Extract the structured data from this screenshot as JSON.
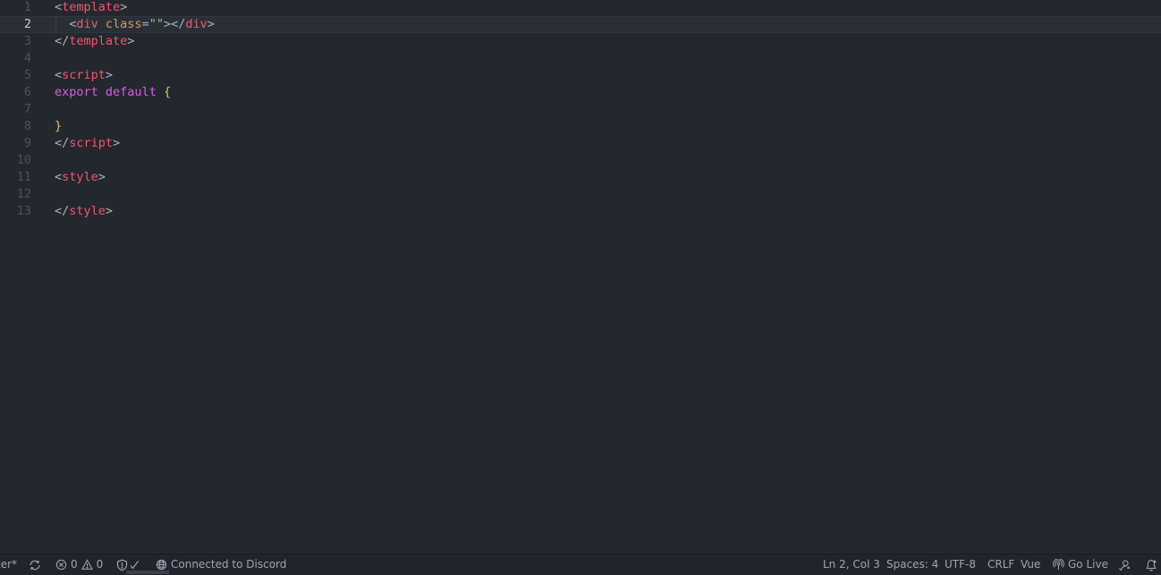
{
  "editor": {
    "current_line": 2,
    "lines": [
      {
        "n": "1",
        "tokens": [
          [
            "t-punc",
            "<"
          ],
          [
            "t-tag",
            "template"
          ],
          [
            "t-punc",
            ">"
          ]
        ]
      },
      {
        "n": "2",
        "tokens": [
          [
            "t-punc",
            "  <"
          ],
          [
            "t-tag",
            "div"
          ],
          [
            "t-punc",
            " "
          ],
          [
            "t-attr",
            "class"
          ],
          [
            "t-punc",
            "="
          ],
          [
            "t-str",
            "\"\""
          ],
          [
            "t-punc",
            "></"
          ],
          [
            "t-tag",
            "div"
          ],
          [
            "t-punc",
            ">"
          ]
        ]
      },
      {
        "n": "3",
        "tokens": [
          [
            "t-punc",
            "</"
          ],
          [
            "t-tag",
            "template"
          ],
          [
            "t-punc",
            ">"
          ]
        ]
      },
      {
        "n": "4",
        "tokens": []
      },
      {
        "n": "5",
        "tokens": [
          [
            "t-punc",
            "<"
          ],
          [
            "t-tag",
            "script"
          ],
          [
            "t-punc",
            ">"
          ]
        ]
      },
      {
        "n": "6",
        "tokens": [
          [
            "t-kw",
            "export"
          ],
          [
            "t-punc",
            " "
          ],
          [
            "t-kw",
            "default"
          ],
          [
            "t-punc",
            " "
          ],
          [
            "t-brace",
            "{"
          ]
        ]
      },
      {
        "n": "7",
        "tokens": []
      },
      {
        "n": "8",
        "tokens": [
          [
            "t-brace",
            "}"
          ]
        ]
      },
      {
        "n": "9",
        "tokens": [
          [
            "t-punc",
            "</"
          ],
          [
            "t-tag",
            "script"
          ],
          [
            "t-punc",
            ">"
          ]
        ]
      },
      {
        "n": "10",
        "tokens": []
      },
      {
        "n": "11",
        "tokens": [
          [
            "t-punc",
            "<"
          ],
          [
            "t-tag",
            "style"
          ],
          [
            "t-punc",
            ">"
          ]
        ]
      },
      {
        "n": "12",
        "tokens": []
      },
      {
        "n": "13",
        "tokens": [
          [
            "t-punc",
            "</"
          ],
          [
            "t-tag",
            "style"
          ],
          [
            "t-punc",
            ">"
          ]
        ]
      }
    ]
  },
  "statusbar": {
    "branch_fragment": "ter*",
    "errors": "0",
    "warnings": "0",
    "discord": "Connected to Discord",
    "cursor_position": "Ln 2, Col 3",
    "indentation": "Spaces: 4",
    "encoding": "UTF-8",
    "line_ending": "CRLF",
    "language": "Vue",
    "go_live": "Go Live"
  },
  "icons": {
    "sync": "sync-icon",
    "error": "error-icon",
    "warning": "warning-icon",
    "shield": "shield-check-icon",
    "globe": "globe-icon",
    "broadcast": "broadcast-icon",
    "feedback": "feedback-icon",
    "bell": "bell-icon"
  },
  "colors": {
    "background": "#23272e",
    "tag": "#ef596f",
    "attribute": "#d19a66",
    "string": "#89ca78",
    "keyword": "#d55fde",
    "brace": "#e5c07b"
  }
}
